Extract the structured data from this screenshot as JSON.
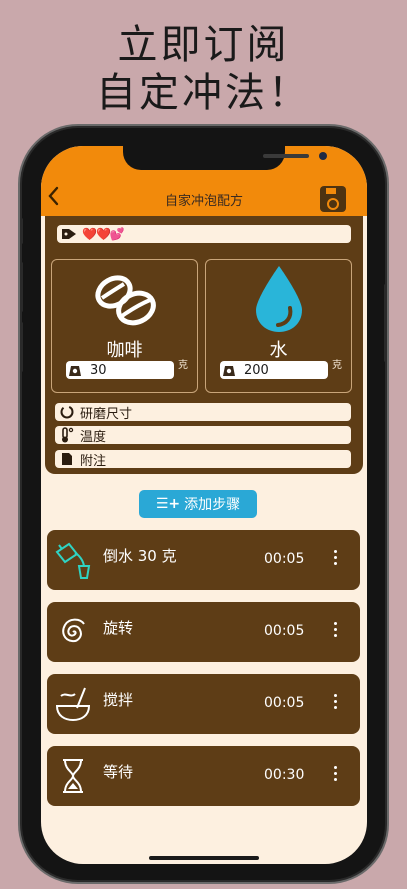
{
  "promo": {
    "line1": "立即订阅",
    "line2": "自定冲法！"
  },
  "header": {
    "title": "自家冲泡配方",
    "back_icon": "chevron-left-icon",
    "save_icon": "floppy-disk-icon"
  },
  "tags": {
    "hearts": "❤️❤️💕"
  },
  "ingredients": {
    "coffee": {
      "label": "咖啡",
      "amount": "30",
      "unit": "克"
    },
    "water": {
      "label": "水",
      "amount": "200",
      "unit": "克"
    }
  },
  "options": [
    {
      "label": "研磨尺寸",
      "icon": "grind-dial-icon"
    },
    {
      "label": "温度",
      "icon": "thermometer-icon"
    },
    {
      "label": "附注",
      "icon": "note-icon"
    }
  ],
  "add_step": {
    "label": "添加步骤"
  },
  "steps": [
    {
      "name": "倒水 30 克",
      "time": "00:05",
      "icon": "kettle-pour-icon"
    },
    {
      "name": "旋转",
      "time": "00:05",
      "icon": "swirl-icon"
    },
    {
      "name": "搅拌",
      "time": "00:05",
      "icon": "stir-bowl-icon"
    },
    {
      "name": "等待",
      "time": "00:30",
      "icon": "hourglass-icon"
    }
  ],
  "colors": {
    "accent": "#f28a0b",
    "panel": "#5e3d16",
    "button": "#2aa8d6",
    "cream": "#fdf0e0",
    "background": "#c9a8ab"
  }
}
